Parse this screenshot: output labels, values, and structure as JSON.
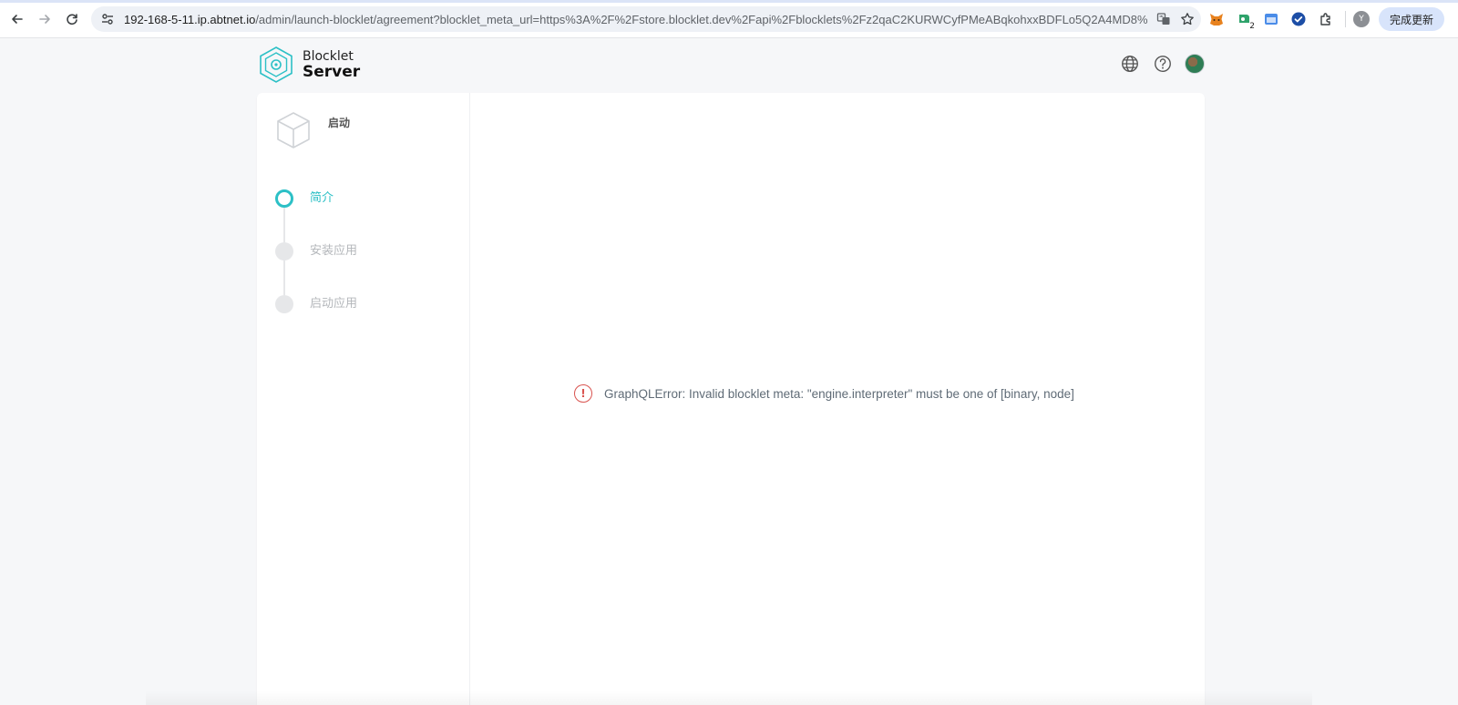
{
  "browser": {
    "url_host": "192-168-5-11.ip.abtnet.io",
    "url_path": "/admin/launch-blocklet/agreement?blocklet_meta_url=https%3A%2F%2Fstore.blocklet.dev%2Fapi%2Fblocklets%2Fz2qaC2KURWCyfPMeABqkohxxBDFLo5Q2A4MD8%2Fblock...",
    "profile_initial": "Y",
    "update_label": "完成更新",
    "extensions": [
      "fox-extension-icon",
      "wallet-extension-icon",
      "window-extension-icon",
      "check-extension-icon",
      "puzzle-extension-icon"
    ],
    "wallet_badge": "2"
  },
  "header": {
    "logo_line1": "Blocklet",
    "logo_line2": "Server"
  },
  "sidebar": {
    "blocklet_name": "启动",
    "steps": [
      {
        "label": "简介",
        "active": true
      },
      {
        "label": "安装应用",
        "active": false
      },
      {
        "label": "启动应用",
        "active": false
      }
    ]
  },
  "content": {
    "error_message": "GraphQLError: Invalid blocklet meta: \"engine.interpreter\" must be one of [binary, node]"
  },
  "colors": {
    "accent": "#2cc0c6",
    "error": "#d9534f",
    "background": "#f6f7f9"
  }
}
